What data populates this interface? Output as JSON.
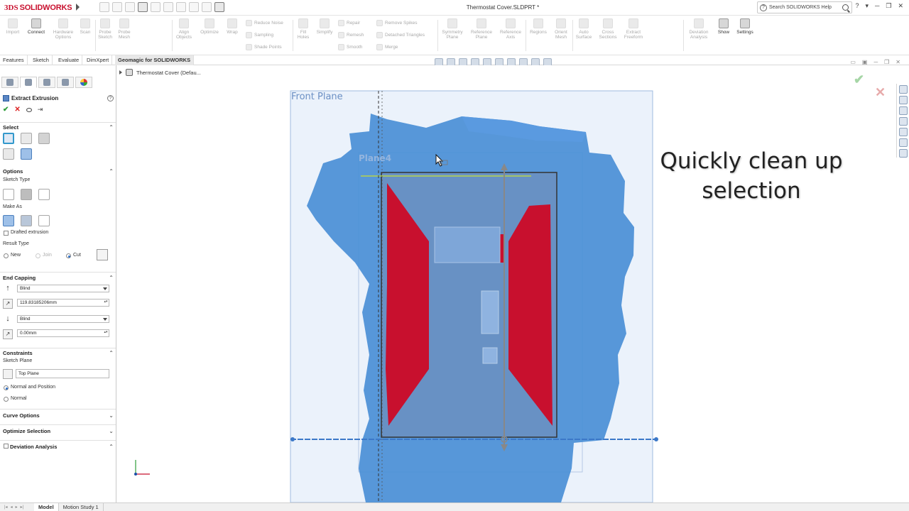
{
  "titlebar": {
    "logo_mark": "3DS",
    "logo_text": "SOLIDWORKS",
    "document_title": "Thermostat Cover.SLDPRT *",
    "help_search_placeholder": "Search SOLIDWORKS Help",
    "help_glyph": "?",
    "window_controls": [
      "?",
      "▾",
      "─",
      "❐",
      "✕"
    ]
  },
  "ribbon": {
    "large_buttons": [
      {
        "label": "Import",
        "enabled": false
      },
      {
        "label": "Connect",
        "enabled": true
      },
      {
        "label": "Hardware\nOptions",
        "enabled": false
      },
      {
        "label": "Scan",
        "enabled": false
      },
      {
        "label": "Probe\nSketch",
        "enabled": false
      },
      {
        "label": "Probe\nMesh",
        "enabled": false
      },
      {
        "label": "Align\nObjects",
        "enabled": false
      },
      {
        "label": "Optimize",
        "enabled": false
      },
      {
        "label": "Wrap",
        "enabled": false
      },
      {
        "label": "Fill\nHoles",
        "enabled": false
      },
      {
        "label": "Simplify",
        "enabled": false
      },
      {
        "label": "Symmetry\nPlane",
        "enabled": false
      },
      {
        "label": "Reference\nPlane",
        "enabled": false
      },
      {
        "label": "Reference\nAxis",
        "enabled": false
      },
      {
        "label": "Regions",
        "enabled": false
      },
      {
        "label": "Orient\nMesh",
        "enabled": false
      },
      {
        "label": "Auto\nSurface",
        "enabled": false
      },
      {
        "label": "Cross\nSections",
        "enabled": false
      },
      {
        "label": "Extract\nFreeform",
        "enabled": false
      },
      {
        "label": "Deviation\nAnalysis",
        "enabled": false
      },
      {
        "label": "Show",
        "enabled": true
      },
      {
        "label": "Settings",
        "enabled": true
      }
    ],
    "small_buttons": {
      "mesh_ops": [
        "Reduce Noise",
        "Sampling",
        "Shade Points"
      ],
      "repair_ops": [
        "Repair",
        "Remesh",
        "Smooth"
      ],
      "spike_ops": [
        "Remove Spikes",
        "Detached Triangles",
        "Merge"
      ]
    }
  },
  "tabs": [
    "Features",
    "Sketch",
    "Evaluate",
    "DimXpert",
    "Geomagic for SOLIDWORKS"
  ],
  "active_tab": "Geomagic for SOLIDWORKS",
  "feature_tree": {
    "root_label": "Thermostat Cover  (Defau..."
  },
  "property_manager": {
    "title": "Extract Extrusion",
    "help_glyph": "?",
    "ok_glyph": "✔",
    "cancel_glyph": "✕",
    "pin_glyph": "⇥",
    "collapse_glyph": "⌃",
    "expand_glyph": "⌄",
    "select": {
      "header": "Select"
    },
    "options": {
      "header": "Options",
      "sketch_type_label": "Sketch Type",
      "make_as_label": "Make As",
      "drafted_extrusion_label": "Drafted extrusion",
      "drafted_extrusion_checked": false,
      "result_type_label": "Result Type",
      "result_types": [
        "New",
        "Join",
        "Cut"
      ],
      "result_type_selected": "Cut"
    },
    "end_capping": {
      "header": "End Capping",
      "direction1_type": "Blind",
      "direction1_value": "119.83185206mm",
      "direction2_type": "Blind",
      "direction2_value": "0.00mm",
      "spin_glyph": "▴▾"
    },
    "constraints": {
      "header": "Constraints",
      "sketch_plane_label": "Sketch Plane",
      "sketch_plane_value": "Top Plane",
      "modes": [
        "Normal and Position",
        "Normal"
      ],
      "mode_selected": "Normal and Position"
    },
    "curve_options": {
      "header": "Curve Options"
    },
    "optimize_selection": {
      "header": "Optimize Selection"
    },
    "deviation_analysis": {
      "header": "Deviation Analysis",
      "checked": false
    }
  },
  "viewport": {
    "front_plane_label": "Front Plane",
    "plane_label": "Plane4",
    "caption_line1": "Quickly clean up",
    "caption_line2": "selection",
    "ok_glyph": "✔",
    "cancel_glyph": "✕",
    "colors": {
      "mesh": "#4a8fd6",
      "selection": "#c8102e",
      "plane": "#dbe8f7"
    }
  },
  "bottom_tabs": [
    "Model",
    "Motion Study 1"
  ],
  "bottom_tab_active": "Model",
  "nav_arrows": [
    "|◂",
    "◂",
    "▸",
    "▸|"
  ]
}
